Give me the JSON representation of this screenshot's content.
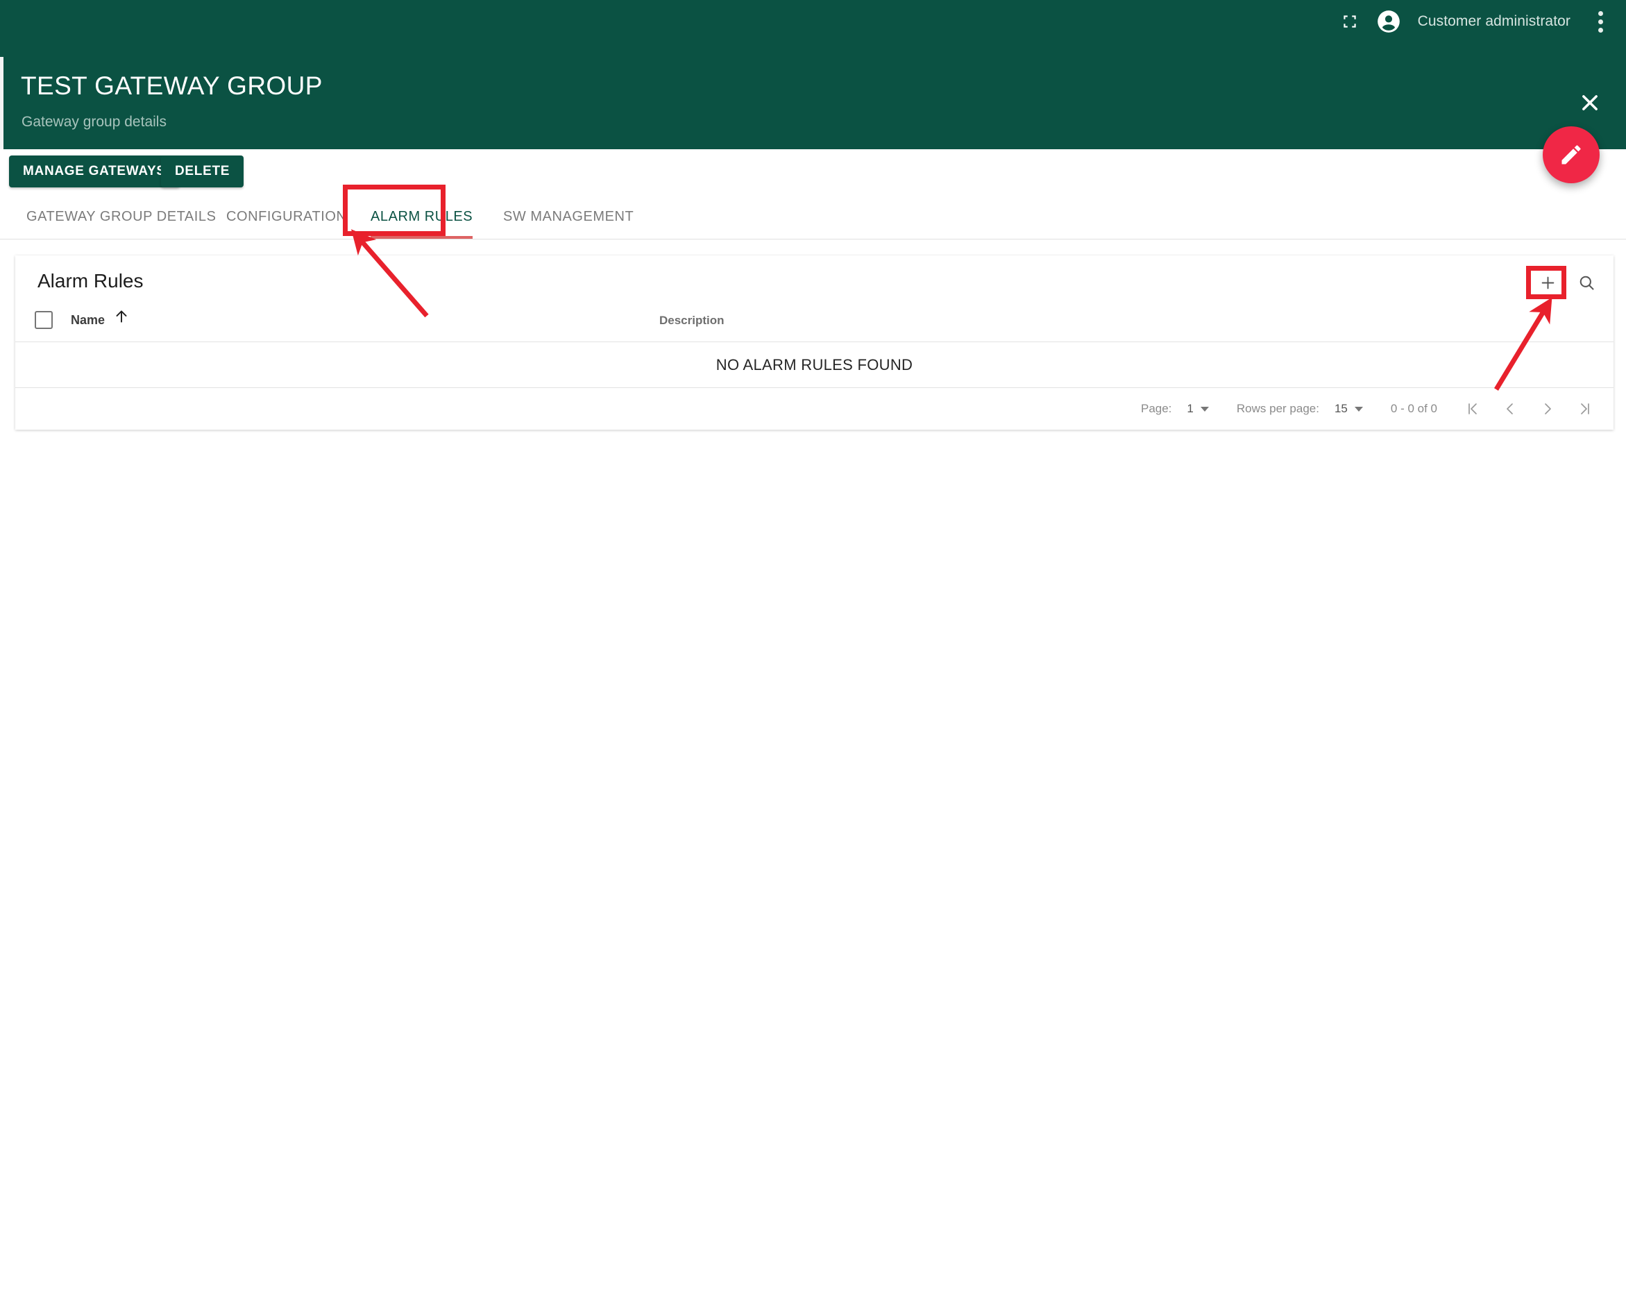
{
  "theme": {
    "header_green": "#0b5243",
    "fab_red": "#f02746",
    "annotation_red": "#e8212c",
    "tab_active_underline": "#de6464",
    "page_background": "#ffffff"
  },
  "topbar": {
    "fullscreen_icon": "fullscreen-icon",
    "account_icon": "account-circle-icon",
    "user_label": "Customer administrator",
    "overflow_icon": "more-vert-icon"
  },
  "header": {
    "title": "TEST GATEWAY GROUP",
    "subtitle": "Gateway group details",
    "close_icon": "close-icon",
    "fab_icon": "pencil-edit-icon"
  },
  "actions": {
    "manage_gateways_label": "MANAGE GATEWAYS",
    "delete_label": "DELETE"
  },
  "tabs": [
    {
      "label": "GATEWAY GROUP DETAILS",
      "active": false
    },
    {
      "label": "CONFIGURATION",
      "active": false
    },
    {
      "label": "ALARM RULES",
      "active": true
    },
    {
      "label": "SW MANAGEMENT",
      "active": false
    }
  ],
  "card": {
    "title": "Alarm Rules",
    "add_icon": "plus-icon",
    "search_icon": "search-icon",
    "columns": [
      "Name",
      "Description"
    ],
    "sort_column": "Name",
    "sort_direction_icon": "arrow-up-icon",
    "select_all_checked": false,
    "rows": [],
    "empty_message": "NO ALARM RULES FOUND"
  },
  "paginator": {
    "page_label": "Page:",
    "page_value": "1",
    "rows_per_page_label": "Rows per page:",
    "rows_per_page_value": "15",
    "range_label": "0 - 0 of 0",
    "first_page_icon": "first-page-icon",
    "prev_page_icon": "chevron-left-icon",
    "next_page_icon": "chevron-right-icon",
    "last_page_icon": "last-page-icon"
  },
  "annotations": {
    "tab_highlight_target": "ALARM RULES",
    "add_button_highlight_target": "plus-icon"
  }
}
